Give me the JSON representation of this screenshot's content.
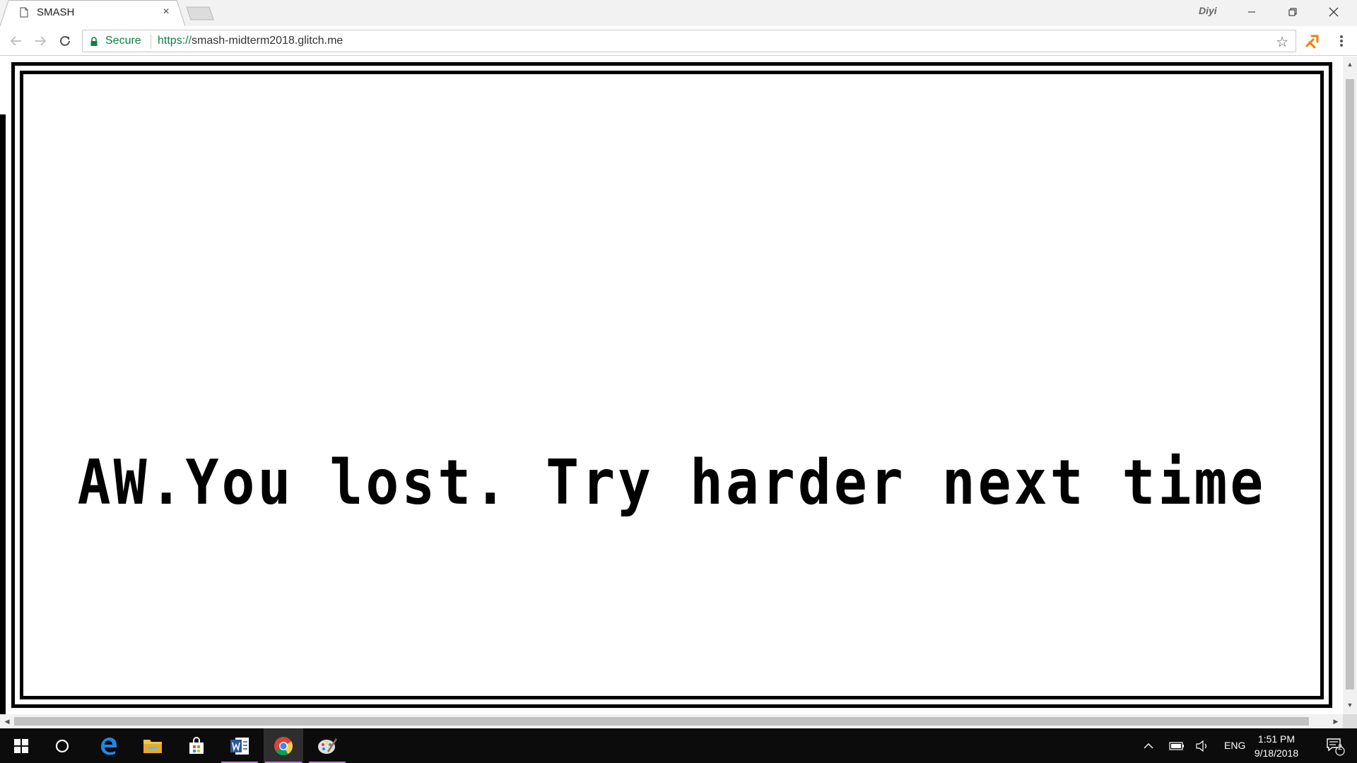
{
  "browser": {
    "tab": {
      "title": "SMASH",
      "close": "×"
    },
    "profile_name": "Diyi",
    "omnibox": {
      "secure_label": "Secure",
      "url_scheme": "https://",
      "url_host": "smash-midterm2018.glitch.me"
    }
  },
  "page": {
    "message": "AW.You lost. Try harder next time"
  },
  "taskbar": {
    "apps": [
      "start-icon",
      "cortana-icon",
      "edge-icon",
      "file-explorer-icon",
      "store-icon",
      "word-icon",
      "chrome-icon",
      "paint-icon"
    ],
    "language": "ENG",
    "time": "1:51 PM",
    "date": "9/18/2018",
    "notification_count": "2"
  },
  "colors": {
    "secure_green": "#0b8043",
    "frame": "#000000",
    "taskbar_bg": "#0c0c0c",
    "running_indicator": "#c77dd6"
  }
}
